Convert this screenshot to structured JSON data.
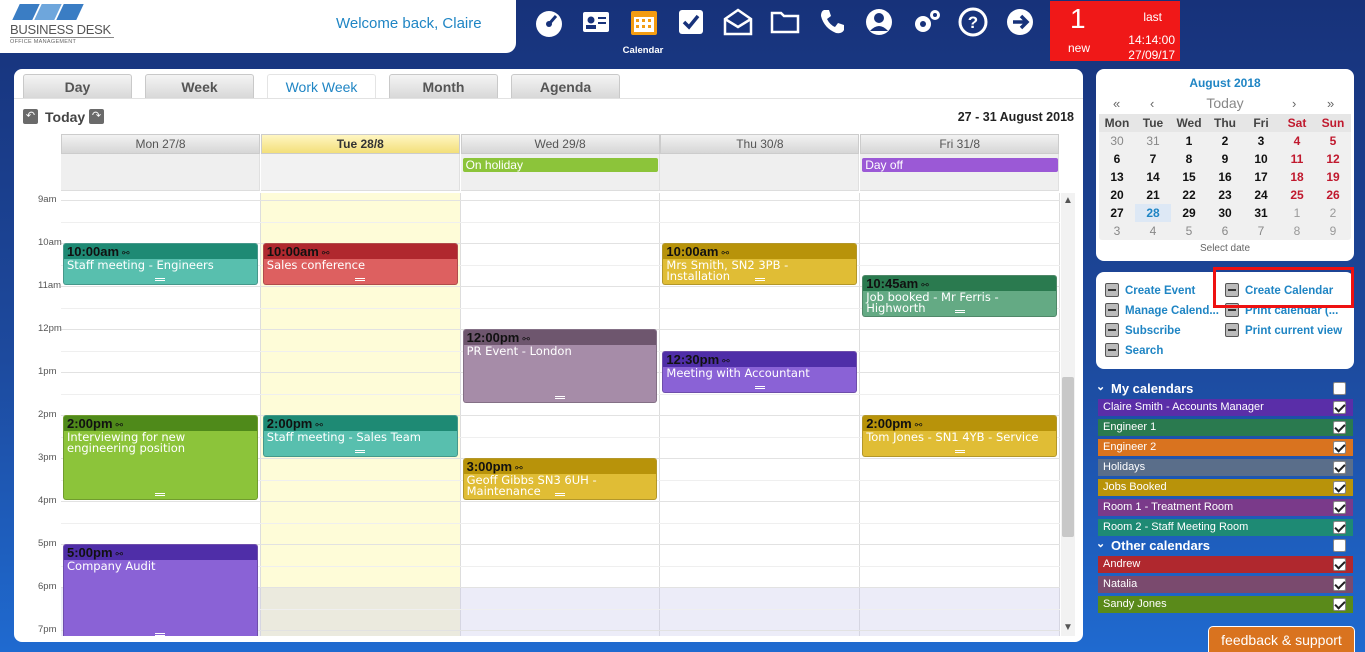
{
  "header": {
    "logo_text": "BUSINESS DESK",
    "logo_sub": "OFFICE MANAGEMENT",
    "welcome": "Welcome back, Claire",
    "active_caption": "Calendar",
    "nav": [
      "dashboard-icon",
      "contacts-icon",
      "calendar-icon",
      "tasks-icon",
      "mail-icon",
      "folder-icon",
      "phone-icon",
      "user-icon",
      "settings-icon",
      "help-icon",
      "logout-icon"
    ]
  },
  "alert": {
    "count": "1",
    "new_label": "new",
    "last_label": "last",
    "time": "14:14:00",
    "date": "27/09/17"
  },
  "tabs": [
    "Day",
    "Week",
    "Work Week",
    "Month",
    "Agenda"
  ],
  "toolbar": {
    "today": "Today",
    "range": "27 - 31 August 2018"
  },
  "days": [
    "Mon 27/8",
    "Tue 28/8",
    "Wed 29/8",
    "Thu 30/8",
    "Fri 31/8"
  ],
  "allday": [
    {
      "day": 2,
      "label": "On holiday",
      "color": "#8cc43a"
    },
    {
      "day": 4,
      "label": "Day off",
      "color": "#9b59d6"
    }
  ],
  "hours": [
    "9am",
    "10am",
    "11am",
    "12pm",
    "1pm",
    "2pm",
    "3pm",
    "4pm",
    "5pm",
    "6pm",
    "7pm"
  ],
  "events": [
    {
      "day": 0,
      "start": 10.0,
      "end": 11.0,
      "time": "10:00am",
      "title": "Staff meeting - Engineers",
      "head": "#1e8a74",
      "body": "#58bfae"
    },
    {
      "day": 1,
      "start": 10.0,
      "end": 11.0,
      "time": "10:00am",
      "title": "Sales conference",
      "head": "#b0282e",
      "body": "#dd6060"
    },
    {
      "day": 3,
      "start": 10.0,
      "end": 11.0,
      "time": "10:00am",
      "title": "Mrs Smith, SN2 3PB - Installation",
      "head": "#b8930a",
      "body": "#e0bd35"
    },
    {
      "day": 4,
      "start": 10.75,
      "end": 11.75,
      "time": "10:45am",
      "title": "Job booked - Mr Ferris - Highworth",
      "head": "#2a7a4f",
      "body": "#64aa84"
    },
    {
      "day": 2,
      "start": 12.0,
      "end": 13.75,
      "time": "12:00pm",
      "title": "PR Event - London",
      "head": "#6e566e",
      "body": "#a68ca8"
    },
    {
      "day": 3,
      "start": 12.5,
      "end": 13.5,
      "time": "12:30pm",
      "title": "Meeting with Accountant",
      "head": "#4f2ea8",
      "body": "#8a62d6"
    },
    {
      "day": 0,
      "start": 14.0,
      "end": 16.0,
      "time": "2:00pm",
      "title": "Interviewing for new engineering position",
      "head": "#4f8a1a",
      "body": "#8cc43a"
    },
    {
      "day": 1,
      "start": 14.0,
      "end": 15.0,
      "time": "2:00pm",
      "title": "Staff meeting - Sales Team",
      "head": "#1e8a74",
      "body": "#58bfae"
    },
    {
      "day": 4,
      "start": 14.0,
      "end": 15.0,
      "time": "2:00pm",
      "title": "Tom Jones - SN1 4YB - Service",
      "head": "#b8930a",
      "body": "#e0bd35"
    },
    {
      "day": 2,
      "start": 15.0,
      "end": 16.0,
      "time": "3:00pm",
      "title": "Geoff Gibbs SN3 6UH - Maintenance",
      "head": "#b8930a",
      "body": "#e0bd35"
    },
    {
      "day": 0,
      "start": 17.0,
      "end": 19.25,
      "time": "5:00pm",
      "title": "Company Audit",
      "head": "#4f2ea8",
      "body": "#8a62d6"
    }
  ],
  "mini": {
    "title": "August 2018",
    "prev_year": "«",
    "prev": "‹",
    "today": "Today",
    "next": "›",
    "next_year": "»",
    "weekdays": [
      "Mon",
      "Tue",
      "Wed",
      "Thu",
      "Fri",
      "Sat",
      "Sun"
    ],
    "weeks": [
      [
        "30",
        "31",
        "1",
        "2",
        "3",
        "4",
        "5"
      ],
      [
        "6",
        "7",
        "8",
        "9",
        "10",
        "11",
        "12"
      ],
      [
        "13",
        "14",
        "15",
        "16",
        "17",
        "18",
        "19"
      ],
      [
        "20",
        "21",
        "22",
        "23",
        "24",
        "25",
        "26"
      ],
      [
        "27",
        "28",
        "29",
        "30",
        "31",
        "1",
        "2"
      ],
      [
        "3",
        "4",
        "5",
        "6",
        "7",
        "8",
        "9"
      ]
    ],
    "selected": "28",
    "select_label": "Select date"
  },
  "actions": [
    {
      "name": "create-event",
      "label": "Create Event"
    },
    {
      "name": "manage-calendars",
      "label": "Manage Calend..."
    },
    {
      "name": "subscribe",
      "label": "Subscribe"
    },
    {
      "name": "search",
      "label": "Search"
    },
    {
      "name": "create-calendar",
      "label": "Create Calendar"
    },
    {
      "name": "print-calendar",
      "label": "Print calendar (..."
    },
    {
      "name": "print-current-view",
      "label": "Print current view"
    }
  ],
  "my_calendars": {
    "title": "My calendars",
    "items": [
      {
        "label": "Claire Smith - Accounts Manager",
        "color": "#5a2ea8"
      },
      {
        "label": "Engineer 1",
        "color": "#2a7a4f"
      },
      {
        "label": "Engineer 2",
        "color": "#d9731f"
      },
      {
        "label": "Holidays",
        "color": "#5a6e8a"
      },
      {
        "label": "Jobs Booked",
        "color": "#b8930a"
      },
      {
        "label": "Room 1 - Treatment Room",
        "color": "#7a3a8a"
      },
      {
        "label": "Room 2 - Staff Meeting Room",
        "color": "#1e8a74"
      }
    ]
  },
  "other_calendars": {
    "title": "Other calendars",
    "items": [
      {
        "label": "Andrew",
        "color": "#b0282e"
      },
      {
        "label": "Natalia",
        "color": "#7a4a6e"
      },
      {
        "label": "Sandy Jones",
        "color": "#5a8a1a"
      }
    ]
  },
  "feedback": "feedback & support"
}
